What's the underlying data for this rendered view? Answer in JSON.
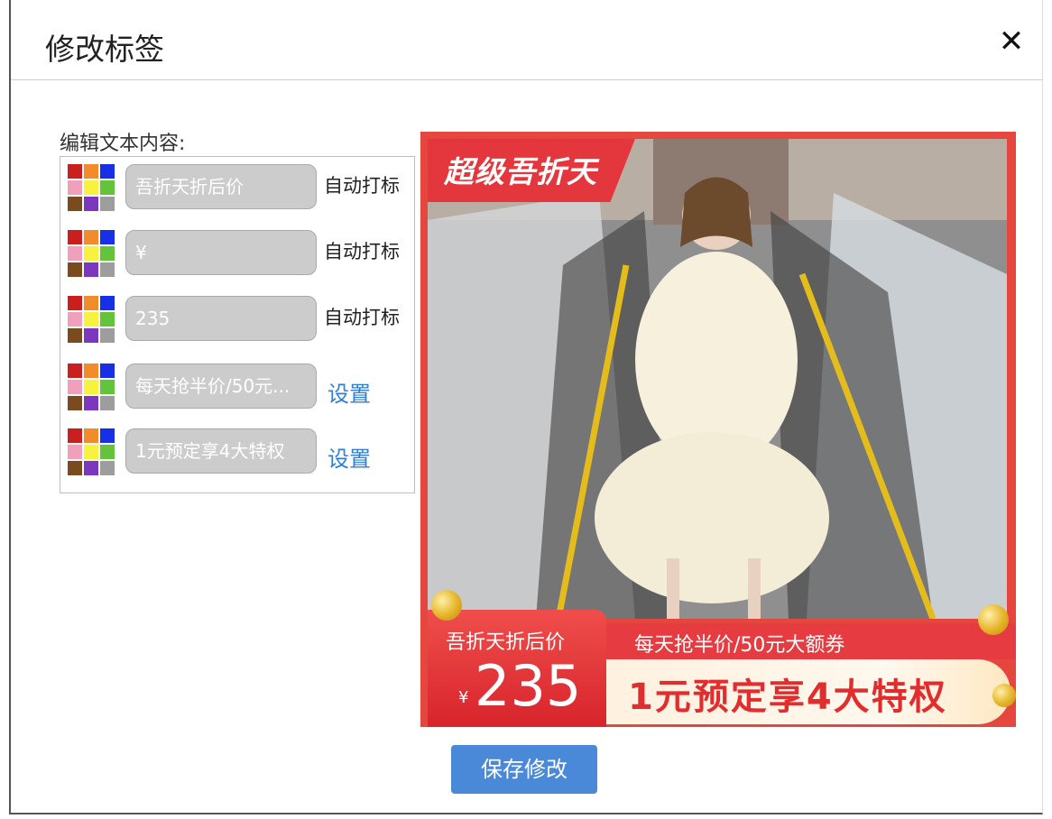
{
  "dialog": {
    "title": "修改标签",
    "close_label": "✕",
    "edit_label": "编辑文本内容:",
    "save_label": "保存修改"
  },
  "palette_colors": [
    "#c91f1f",
    "#f28b2a",
    "#1730e6",
    "#f1a0bc",
    "#f6f23d",
    "#63c33b",
    "#7b4b20",
    "#7b38bf",
    "#9d9d9d"
  ],
  "rows": [
    {
      "value": "吾折天折后价",
      "action": "自动打标",
      "action_type": "text"
    },
    {
      "value": "¥",
      "action": "自动打标",
      "action_type": "text"
    },
    {
      "value": "235",
      "action": "自动打标",
      "action_type": "text"
    },
    {
      "value": "每天抢半价/50元...",
      "action": "设置",
      "action_type": "link"
    },
    {
      "value": "1元预定享4大特权",
      "action": "设置",
      "action_type": "link"
    }
  ],
  "preview": {
    "top_banner": "超级吾折天",
    "price_label": "吾折天折后价",
    "currency": "¥",
    "price": "235",
    "promo_small": "每天抢半价/50元大额券",
    "promo_big": "1元预定享4大特权"
  }
}
